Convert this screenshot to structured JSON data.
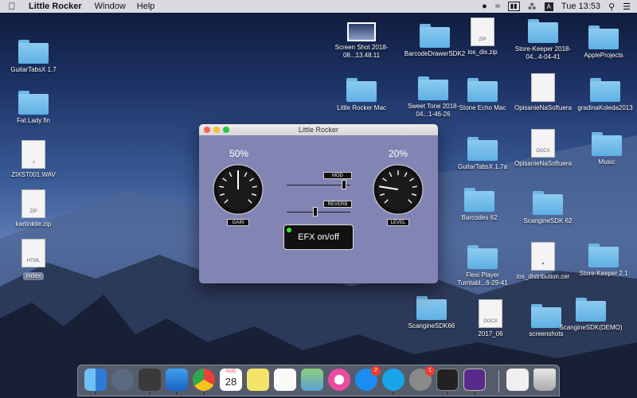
{
  "menubar": {
    "app_name": "Little Rocker",
    "menus": [
      "Window",
      "Help"
    ],
    "input_source": "A",
    "clock": "Tue 13:53"
  },
  "desktop": {
    "left_icons": [
      {
        "label": "GuitarTabsX 1.7",
        "kind": "folder"
      },
      {
        "label": "Fat Lady fin",
        "kind": "folder"
      },
      {
        "label": "ZIXST001.WAV",
        "kind": "doc"
      },
      {
        "label": "kartinkite.zip",
        "kind": "zip"
      },
      {
        "label": "index",
        "kind": "html"
      }
    ],
    "right_icons": [
      {
        "label": "Screen Shot 2018-08...13.48.11",
        "kind": "image"
      },
      {
        "label": "BarcodeDrawerSDK2",
        "kind": "folder"
      },
      {
        "label": "ios_dis.zip",
        "kind": "zip"
      },
      {
        "label": "Store-Keeper 2018-04...4-04-41",
        "kind": "folder"
      },
      {
        "label": "AppleProjects",
        "kind": "folder"
      },
      {
        "label": "Little Rocker Mac",
        "kind": "folder"
      },
      {
        "label": "Sweet Tone 2018-04...1-46-26",
        "kind": "folder"
      },
      {
        "label": "Stone Echo Mac",
        "kind": "folder"
      },
      {
        "label": "OpisanieNaSoftuera",
        "kind": "doc"
      },
      {
        "label": "gradinaKoleda2013",
        "kind": "folder"
      },
      {
        "label": "GuitarTabsX 1.7a",
        "kind": "folder"
      },
      {
        "label": "OpisanieNaSoftuera",
        "kind": "docx"
      },
      {
        "label": "Music",
        "kind": "folder"
      },
      {
        "label": "Barcodes 62",
        "kind": "folder"
      },
      {
        "label": "ScangineSDK 62",
        "kind": "folder"
      },
      {
        "label": "Flexi Player Turntabl...6-29-41",
        "kind": "folder"
      },
      {
        "label": "ios_distribution.cer",
        "kind": "cert"
      },
      {
        "label": "Store-Keeper 2.1",
        "kind": "folder"
      },
      {
        "label": "ScangineSDK66",
        "kind": "folder"
      },
      {
        "label": "2017_06",
        "kind": "docx"
      },
      {
        "label": "screenshots",
        "kind": "folder"
      },
      {
        "label": "ScangineSDK(DEMO)",
        "kind": "folder"
      }
    ]
  },
  "window": {
    "title": "Little Rocker",
    "gain": {
      "percent_label": "50%",
      "label": "GAIN",
      "value": 0.5
    },
    "level": {
      "percent_label": "20%",
      "label": "LEVEL",
      "value": 0.2
    },
    "mod": {
      "label": "MOD",
      "value": 0.9
    },
    "reverb": {
      "label": "REVERB",
      "value": 0.45
    },
    "efx_button": "EFX on/off",
    "efx_on": true
  },
  "dock": {
    "apps": [
      "finder-icon",
      "launchpad-icon",
      "calculator-icon",
      "xcode-icon",
      "chrome-icon",
      "calendar-icon",
      "notes-icon",
      "reminders-icon",
      "maps-icon",
      "itunes-icon",
      "app-store-icon",
      "skype-icon",
      "system-preferences-icon",
      "instruments-icon",
      "little-rocker-icon"
    ],
    "calendar_day": "28",
    "calendar_month": "AUG",
    "app_store_badge": "2",
    "sysprefs_badge": "1"
  }
}
